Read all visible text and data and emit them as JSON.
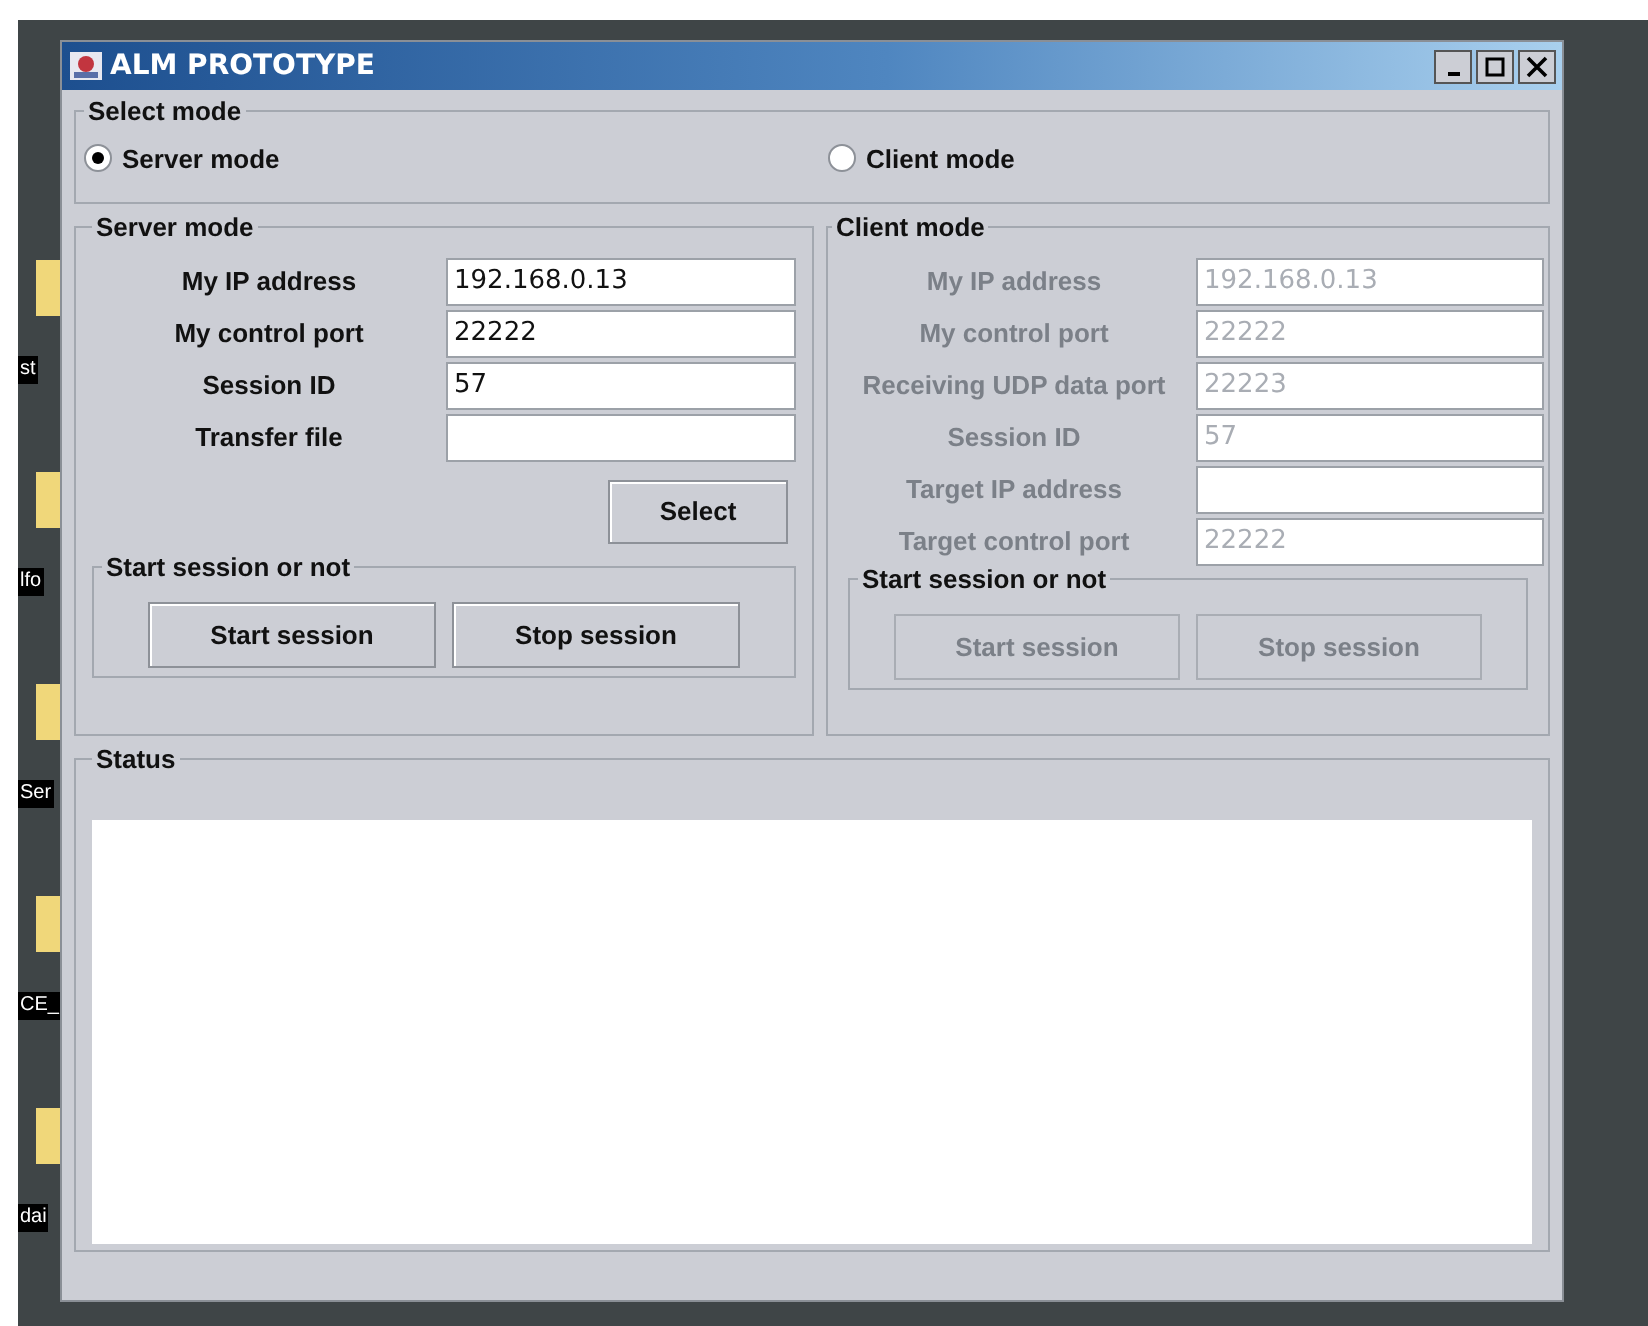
{
  "desktop_icons": [
    {
      "label": "st"
    },
    {
      "label": "lfo"
    },
    {
      "label": "Ser"
    },
    {
      "label": "CE_"
    },
    {
      "label": "dai"
    }
  ],
  "window": {
    "title": "ALM PROTOTYPE"
  },
  "select_mode": {
    "title": "Select mode",
    "options": [
      {
        "label": "Server mode",
        "selected": true
      },
      {
        "label": "Client mode",
        "selected": false
      }
    ]
  },
  "server_panel": {
    "title": "Server mode",
    "disabled": false,
    "fields": [
      {
        "label": "My IP address",
        "value": "192.168.0.13"
      },
      {
        "label": "My control port",
        "value": "22222"
      },
      {
        "label": "Session ID",
        "value": "57"
      },
      {
        "label": "Transfer file"
      }
    ],
    "select_button": "Select",
    "session": {
      "title": "Start session or not",
      "buttons": [
        "Start session",
        "Stop session"
      ]
    }
  },
  "client_panel": {
    "title": "Client mode",
    "disabled": true,
    "fields": [
      {
        "label": "My IP address",
        "value": "192.168.0.13"
      },
      {
        "label": "My control port",
        "value": "22222"
      },
      {
        "label": "Receiving UDP data port",
        "value": "22223"
      },
      {
        "label": "Session ID",
        "value": "57"
      },
      {
        "label": "Target IP address"
      },
      {
        "label": "Target control port",
        "value": "22222"
      }
    ],
    "session": {
      "title": "Start session or not",
      "buttons": [
        "Start session",
        "Stop session"
      ]
    }
  },
  "status": {
    "title": "Status"
  }
}
